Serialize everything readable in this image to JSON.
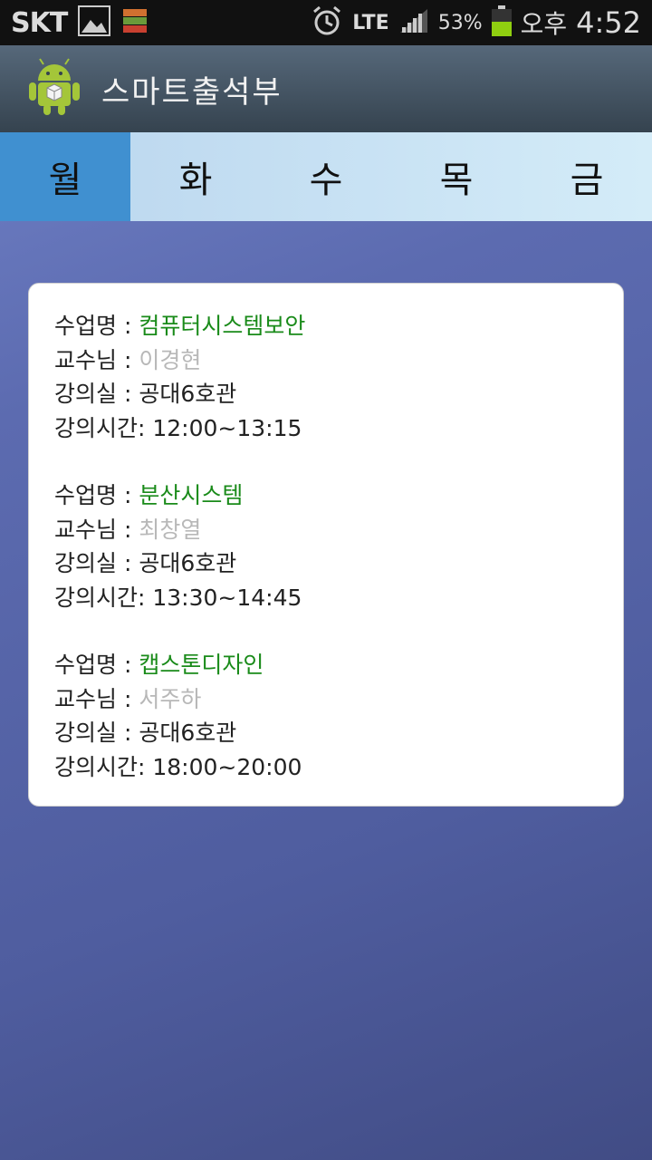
{
  "status_bar": {
    "carrier": "SKT",
    "network": "LTE",
    "battery": "53%",
    "ampm": "오후",
    "time": "4:52"
  },
  "action_bar": {
    "title": "스마트출석부",
    "icon": "android-icon"
  },
  "tabs": [
    {
      "label": "월",
      "active": true
    },
    {
      "label": "화"
    },
    {
      "label": "수"
    },
    {
      "label": "목"
    },
    {
      "label": "금"
    }
  ],
  "labels": {
    "course": "수업명 : ",
    "professor": "교수님 : ",
    "room": "강의실 : ",
    "time": "강의시간: "
  },
  "courses": [
    {
      "name": "컴퓨터시스템보안",
      "professor": "이경현",
      "room": "공대6호관",
      "time": "12:00~13:15"
    },
    {
      "name": "분산시스템",
      "professor": "최창열",
      "room": "공대6호관",
      "time": "13:30~14:45"
    },
    {
      "name": "캡스톤디자인",
      "professor": "서주하",
      "room": "공대6호관",
      "time": "18:00~20:00"
    }
  ],
  "colors": {
    "course_name": "#1a8b1a",
    "professor_name": "#b8b8b8",
    "active_tab": "#4090d0"
  }
}
